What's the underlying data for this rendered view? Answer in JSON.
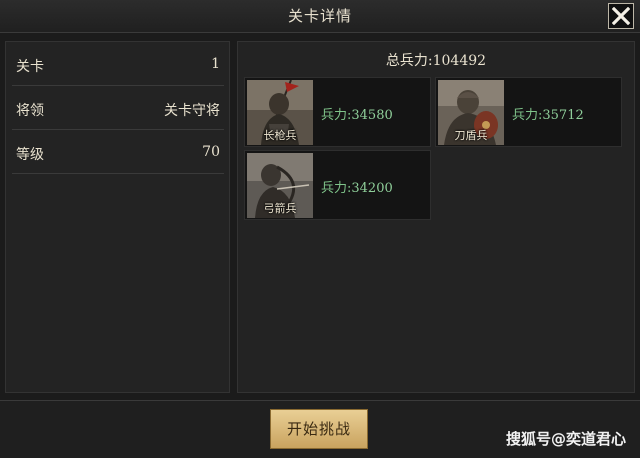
{
  "window": {
    "title": "关卡详情",
    "close_icon": "close-icon"
  },
  "info": {
    "rows": [
      {
        "label": "关卡",
        "value": "1"
      },
      {
        "label": "将领",
        "value": "关卡守将"
      },
      {
        "label": "等级",
        "value": "70"
      }
    ]
  },
  "army": {
    "total_power": "总兵力:104492",
    "units": [
      {
        "name": "长枪兵",
        "power_label": "兵力:",
        "power": "34580"
      },
      {
        "name": "刀盾兵",
        "power_label": "兵力:",
        "power": "35712"
      },
      {
        "name": "弓箭兵",
        "power_label": "兵力:",
        "power": "34200"
      }
    ]
  },
  "actions": {
    "start_label": "开始挑战"
  },
  "watermark": "搜狐号@奕道君心",
  "colors": {
    "background": "#1b1b1b",
    "panel": "#232323",
    "power_green": "#7fc48a",
    "button_gold": "#d9b775"
  }
}
